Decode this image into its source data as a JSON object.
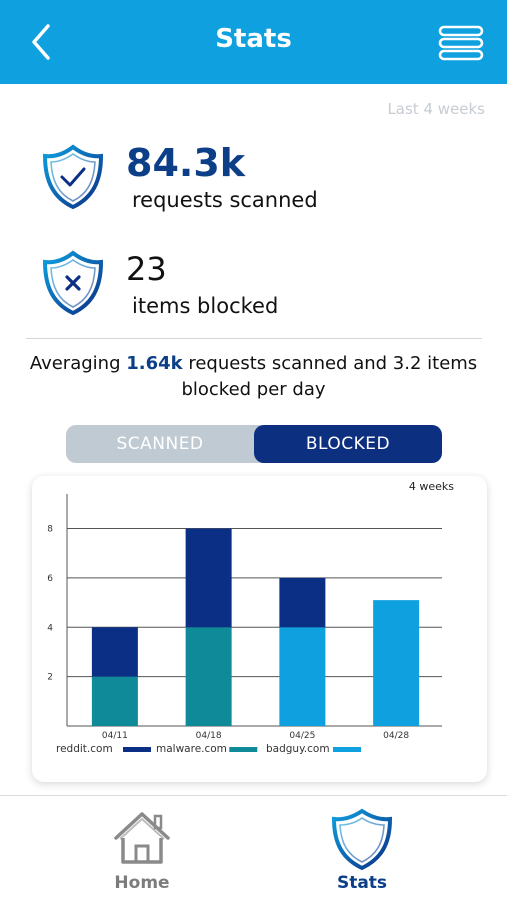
{
  "header": {
    "title": "Stats",
    "back_icon": "chevron-left-icon",
    "menu_icon": "hamburger-menu-icon",
    "color": "#0ea0df"
  },
  "period_label": "Last 4 weeks",
  "stats": {
    "scanned": {
      "value": "84.3k",
      "label": "requests scanned",
      "icon": "shield-check-icon"
    },
    "blocked": {
      "value": "23",
      "label": "items blocked",
      "icon": "shield-x-icon"
    }
  },
  "average": {
    "prefix": "Averaging ",
    "scanned_value": "1.64k",
    "suffix": " requests scanned and 3.2 items blocked per day"
  },
  "toggle": {
    "scanned_label": "SCANNED",
    "blocked_label": "BLOCKED",
    "selected": "BLOCKED"
  },
  "chart_data": {
    "type": "bar",
    "stacked": true,
    "range_label": "4 weeks",
    "categories": [
      "04/11",
      "04/18",
      "04/25",
      "04/28"
    ],
    "series": [
      {
        "name": "reddit.com",
        "color": "#0c2f86",
        "values": [
          2,
          4,
          2,
          0
        ]
      },
      {
        "name": "malware.com",
        "color": "#0f8a98",
        "values": [
          2,
          4,
          0,
          0
        ]
      },
      {
        "name": "badguy.com",
        "color": "#0ea0df",
        "values": [
          0,
          0,
          4,
          5.1
        ]
      }
    ],
    "order_bottom_to_top": [
      [
        "malware.com",
        "reddit.com"
      ],
      [
        "malware.com",
        "reddit.com"
      ],
      [
        "badguy.com",
        "reddit.com"
      ],
      [
        "badguy.com"
      ]
    ],
    "y_ticks": [
      2,
      4,
      6,
      8
    ],
    "ylim": [
      0,
      9.4
    ],
    "grid": true,
    "legend_position": "bottom-left"
  },
  "footer": {
    "home_label": "Home",
    "stats_label": "Stats",
    "active": "Stats"
  }
}
